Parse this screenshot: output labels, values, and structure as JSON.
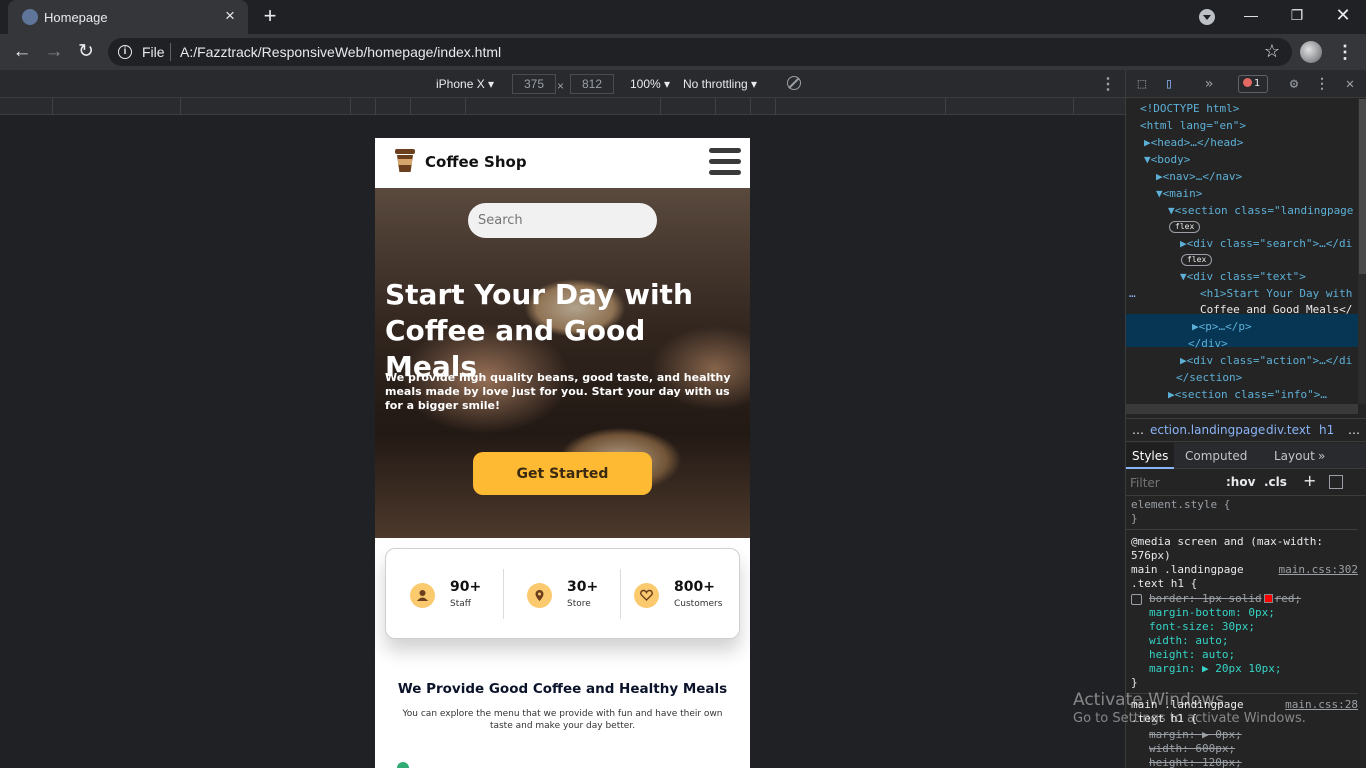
{
  "browser": {
    "tab_title": "Homepage",
    "new_tab": "+",
    "omnibox_scheme": "File",
    "url": "A:/Fazztrack/ResponsiveWeb/homepage/index.html",
    "window": {
      "minimize": "—",
      "restore": "❐",
      "close": "✕"
    }
  },
  "device_toolbar": {
    "device": "iPhone X ▾",
    "width": "375",
    "height": "812",
    "x": "×",
    "zoom": "100% ▾",
    "throttling": "No throttling ▾"
  },
  "page": {
    "brand": "Coffee Shop",
    "search_placeholder": "Search",
    "hero_title": "Start Your Day with Coffee and Good Meals",
    "hero_text": "We provide high quality beans, good taste, and healthy meals made by love just for you. Start your day with us for a bigger smile!",
    "cta": "Get Started",
    "stats": [
      {
        "value": "90+",
        "label": "Staff",
        "icon": "person-icon"
      },
      {
        "value": "30+",
        "label": "Store",
        "icon": "location-pin-icon"
      },
      {
        "value": "800+",
        "label": "Customers",
        "icon": "heart-icon"
      }
    ],
    "section_title": "We Provide Good Coffee and Healthy Meals",
    "section_text": "You can explore the menu that we provide with fun and have their own taste and make your day better."
  },
  "devtools": {
    "error_count": "1",
    "dom": [
      "<!DOCTYPE html>",
      "<html lang=\"en\">",
      "▶<head>…</head>",
      "▼<body>",
      "▶<nav>…</nav>",
      "▼<main>",
      "▼<section class=\"landingpage",
      "▶<div class=\"search\">…</di",
      "▼<div class=\"text\">",
      "<h1>Start Your Day with",
      "Coffee and Good Meals</",
      "▶<p>…</p>",
      "</div>",
      "▶<div class=\"action\">…</di",
      "</section>",
      "▶<section class=\"info\">…"
    ],
    "flex_badge": "flex",
    "ellipsis": "…",
    "breadcrumbs": [
      "…",
      "ection.landingpage",
      "div.text",
      "h1",
      "…"
    ],
    "tabs": [
      "Styles",
      "Computed",
      "Layout",
      "»"
    ],
    "filter_placeholder": "Filter",
    "hov": ":hov",
    "cls": ".cls",
    "styles": {
      "element_style": "element.style {",
      "close_brace": "}",
      "media": "@media screen and (max-width:",
      "media2": "576px)",
      "rule1_selector": "main .landingpage",
      "rule1_selector2": ".text h1 {",
      "rule1_file": "main.css:302",
      "rule1_props": [
        "border: 1px solid",
        "margin-bottom: 0px;",
        "font-size: 30px;",
        "width: auto;",
        "height: auto;",
        "margin: ▶ 20px 10px;"
      ],
      "rule1_border_value": "red;",
      "rule2_selector": "main .landingpage",
      "rule2_selector2": ".text h1 {",
      "rule2_file": "main.css:28",
      "rule2_props": [
        "margin: ▶ 0px;",
        "width: 600px;",
        "height: 120px;"
      ]
    }
  },
  "watermark": {
    "line1": "Activate Windows",
    "line2": "Go to Settings to activate Windows."
  },
  "colors": {
    "accent": "#ffba33",
    "devtools_selection": "#073655"
  }
}
